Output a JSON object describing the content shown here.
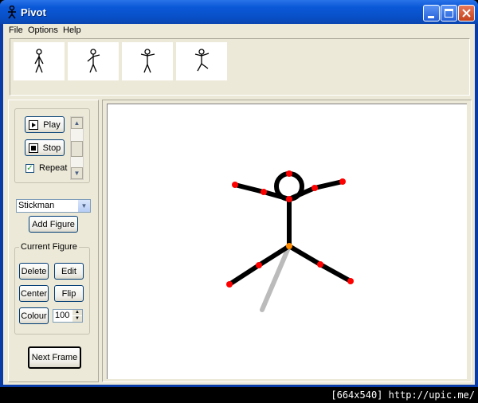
{
  "window": {
    "title": "Pivot"
  },
  "menu": [
    "File",
    "Options",
    "Help"
  ],
  "controls": {
    "play_label": "Play",
    "stop_label": "Stop",
    "repeat_label": "Repeat",
    "repeat_checked": true,
    "figure_select": "Stickman",
    "add_figure_label": "Add Figure",
    "current_figure_label": "Current Figure",
    "delete_label": "Delete",
    "edit_label": "Edit",
    "center_label": "Center",
    "flip_label": "Flip",
    "colour_label": "Colour",
    "colour_value": "100",
    "next_frame_label": "Next Frame"
  },
  "footer": "[664x540] http://upic.me/",
  "colors": {
    "titlebar": "#0b58d8",
    "joint_handle": "#ff0000",
    "origin_handle": "#ff8c00",
    "figure": "#000000",
    "previous_frame": "#bbbbbb"
  }
}
